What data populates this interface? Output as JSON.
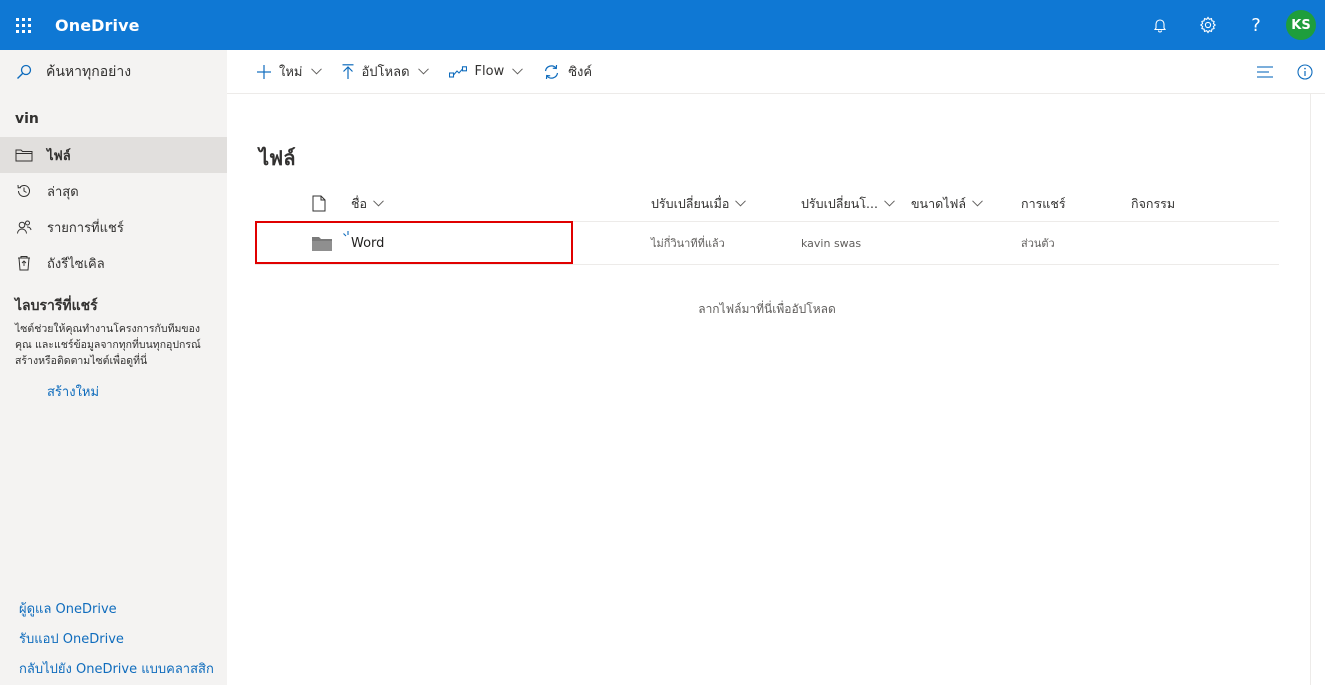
{
  "app": {
    "title": "OneDrive",
    "user_initials": "KS",
    "accent_color": "#0f78d4",
    "avatar_color": "#1e9e3c"
  },
  "top_icons": [
    "bell-icon",
    "gear-icon",
    "help-icon"
  ],
  "help_glyph": "?",
  "leftnav": {
    "search_label": "ค้นหาทุกอย่าง",
    "user_name": "vin",
    "items": [
      {
        "label": "ไฟล์",
        "icon": "folder-icon",
        "active": true
      },
      {
        "label": "ล่าสุด",
        "icon": "recent-icon",
        "active": false
      },
      {
        "label": "รายการที่แชร์",
        "icon": "shared-icon",
        "active": false
      },
      {
        "label": "ถังรีไซเคิล",
        "icon": "recycle-bin-icon",
        "active": false
      }
    ],
    "shared_libraries_title": "ไลบรารีที่แชร์",
    "shared_libraries_desc": "ไซต์ช่วยให้คุณทำงานโครงการกับทีมของคุณ และแชร์ข้อมูลจากทุกที่บนทุกอุปกรณ์ สร้างหรือติดตามไซต์เพื่อดูที่นี่",
    "create_new": "สร้างใหม่",
    "bottom_links": [
      "ผู้ดูแล OneDrive",
      "รับแอป OneDrive",
      "กลับไปยัง OneDrive แบบคลาสสิก"
    ]
  },
  "commandbar": {
    "new": "ใหม่",
    "upload": "อัปโหลด",
    "flow": "Flow",
    "sync": "ซิงค์"
  },
  "main": {
    "title": "ไฟล์",
    "columns": {
      "name": "ชื่อ",
      "modified": "ปรับเปลี่ยนเมื่อ",
      "modified_by": "ปรับเปลี่ยนโ...",
      "size": "ขนาดไฟล์",
      "sharing": "การแชร์",
      "activity": "กิจกรรม"
    },
    "rows": [
      {
        "name": "Word",
        "modified": "ไม่กี่วินาทีที่แล้ว",
        "modified_by": "kavin swas",
        "size": "",
        "sharing": "ส่วนตัว",
        "activity": ""
      }
    ],
    "drop_hint": "ลากไฟล์มาที่นี่เพื่ออัปโหลด"
  }
}
